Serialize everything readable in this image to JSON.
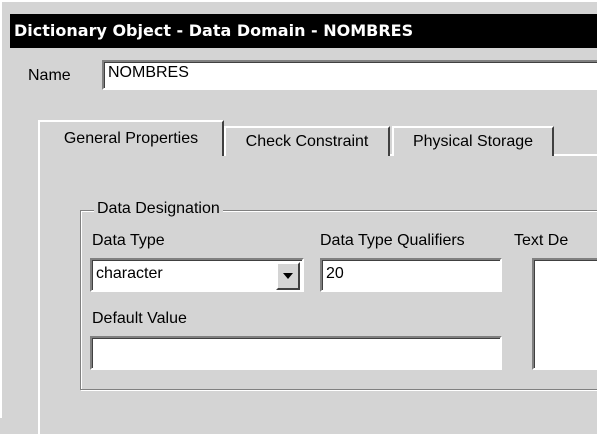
{
  "window": {
    "title": "Dictionary Object - Data Domain - NOMBRES"
  },
  "name_field": {
    "label": "Name",
    "value": "NOMBRES"
  },
  "tabs": [
    {
      "label": "General Properties",
      "active": true
    },
    {
      "label": "Check Constraint",
      "active": false
    },
    {
      "label": "Physical Storage",
      "active": false
    }
  ],
  "data_designation": {
    "group_title": "Data Designation",
    "data_type": {
      "label": "Data Type",
      "value": "character"
    },
    "qualifiers": {
      "label": "Data Type Qualifiers",
      "value": "20"
    },
    "text_description": {
      "label": "Text De",
      "value": ""
    },
    "default_value": {
      "label": "Default Value",
      "value": ""
    }
  }
}
